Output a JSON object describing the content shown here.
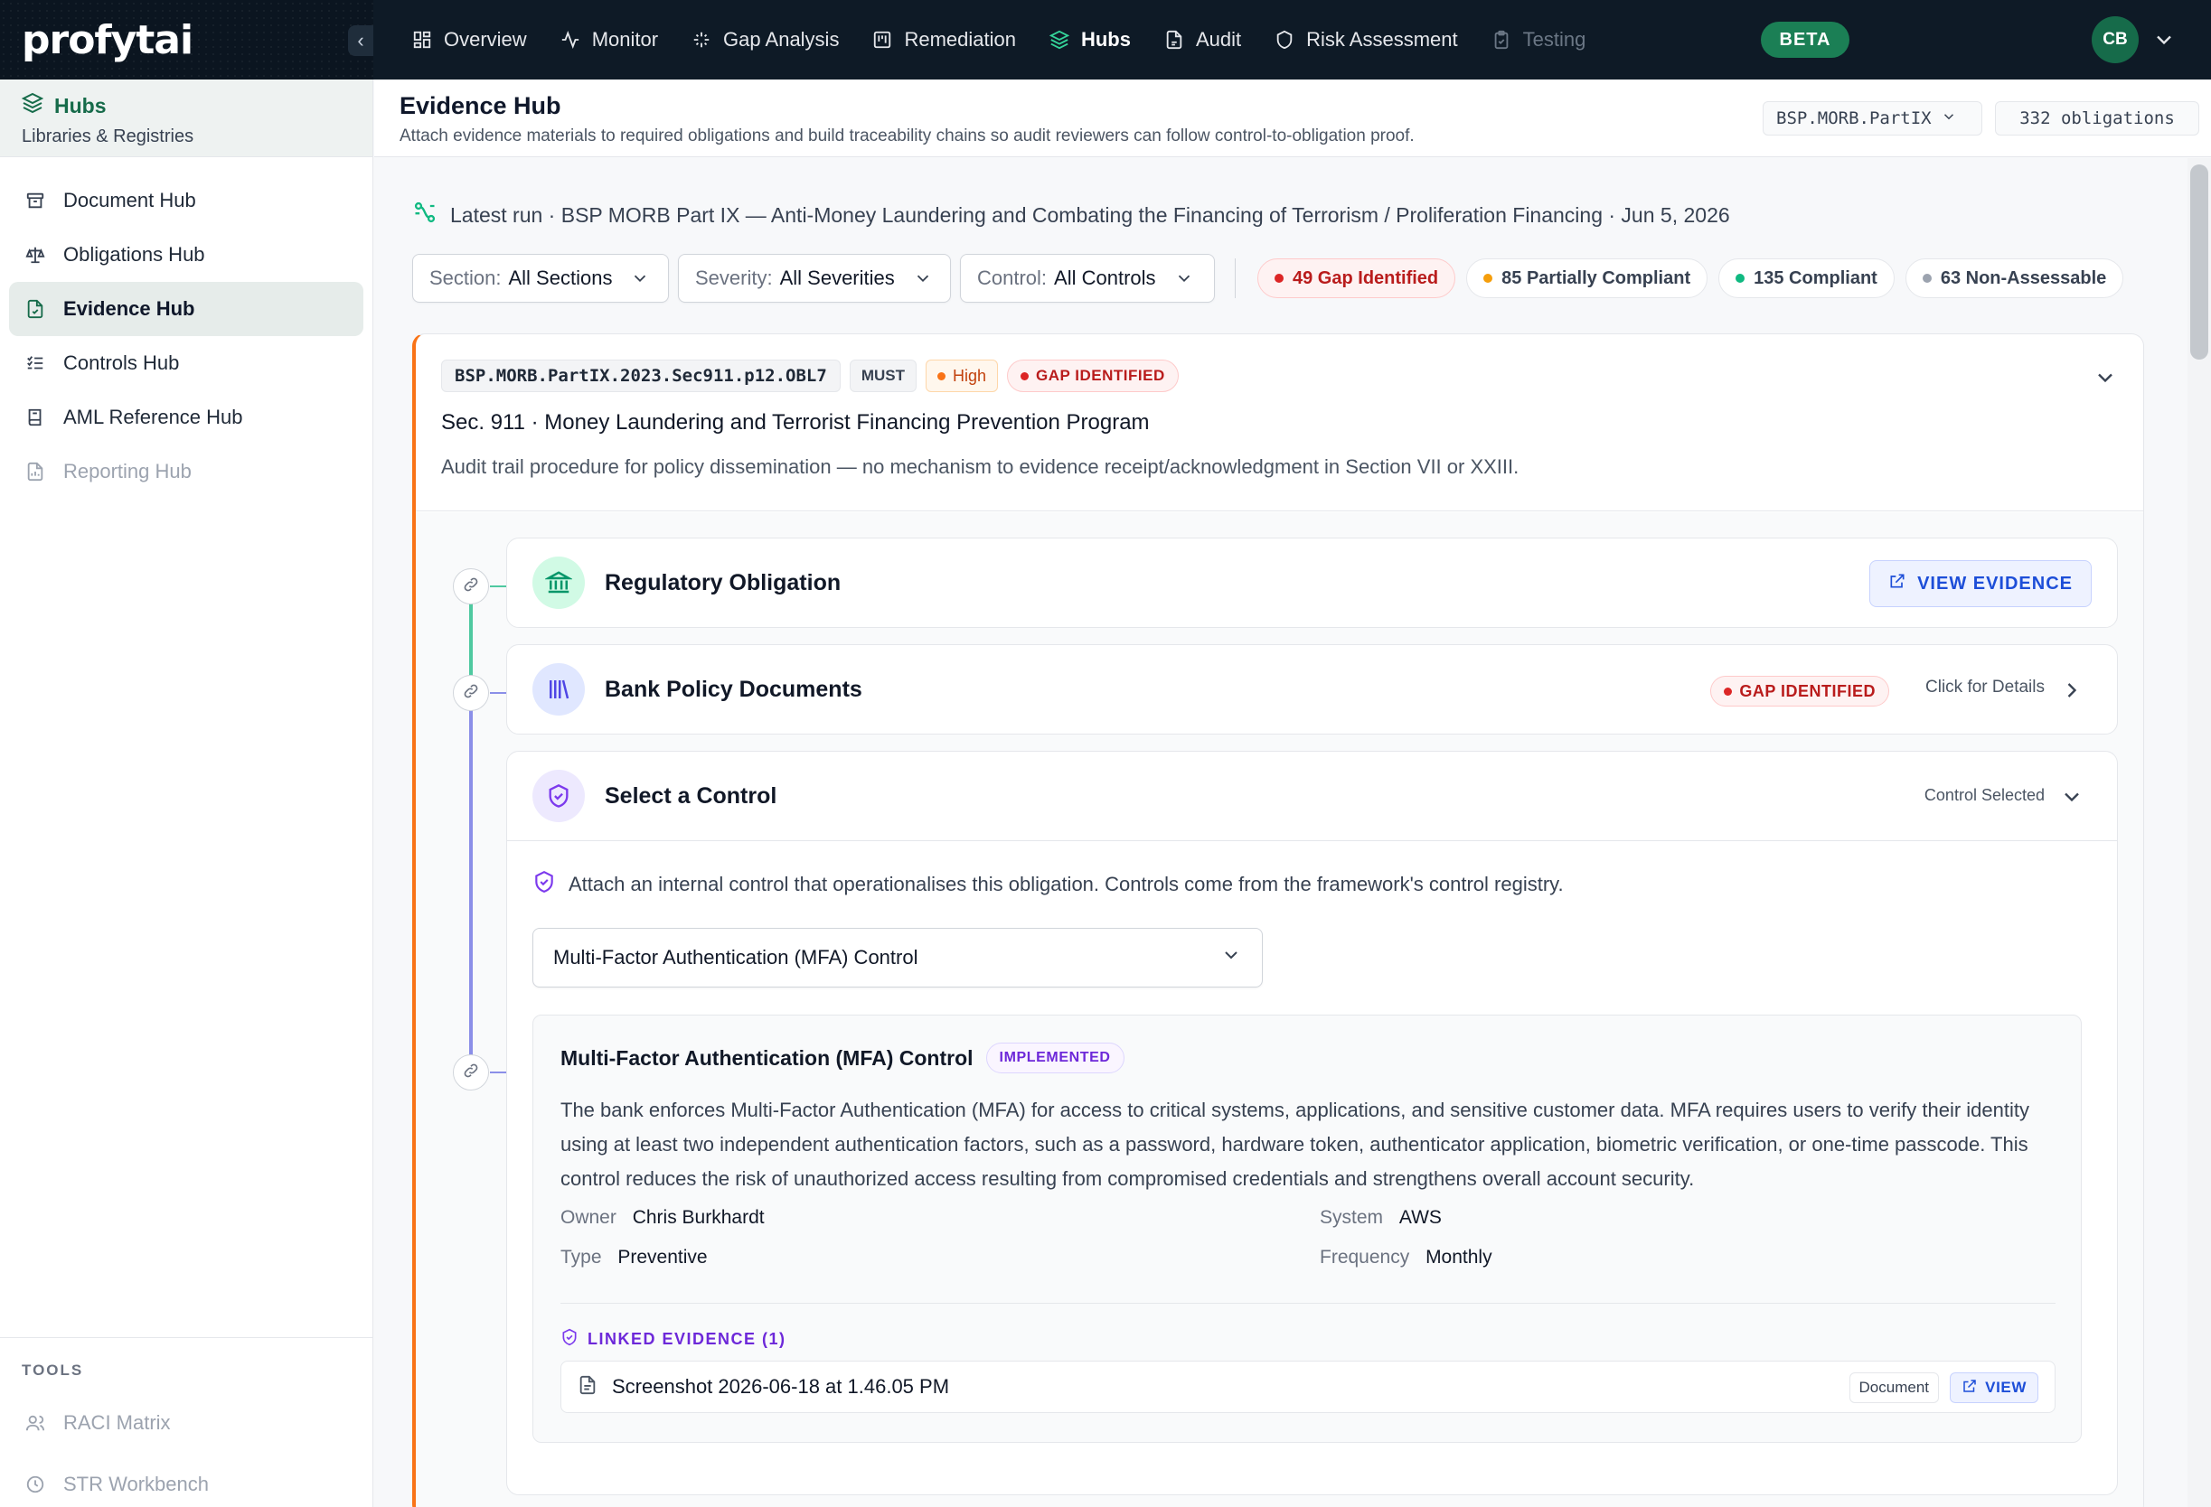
{
  "brand": {
    "logo_text": "profytai"
  },
  "nav": {
    "items": [
      {
        "label": "Overview",
        "icon": "grid-icon"
      },
      {
        "label": "Monitor",
        "icon": "activity-icon"
      },
      {
        "label": "Gap Analysis",
        "icon": "sparkle-icon"
      },
      {
        "label": "Remediation",
        "icon": "board-icon"
      },
      {
        "label": "Hubs",
        "icon": "layers-icon",
        "active": true
      },
      {
        "label": "Audit",
        "icon": "file-icon"
      },
      {
        "label": "Risk Assessment",
        "icon": "shield-icon"
      },
      {
        "label": "Testing",
        "icon": "clipboard-icon",
        "disabled": true
      }
    ],
    "beta_label": "BETA",
    "avatar_initials": "CB"
  },
  "sidebar": {
    "title": "Hubs",
    "subtitle": "Libraries & Registries",
    "items": [
      {
        "label": "Document Hub",
        "icon": "archive-icon"
      },
      {
        "label": "Obligations Hub",
        "icon": "scale-icon"
      },
      {
        "label": "Evidence Hub",
        "icon": "file-check-icon",
        "active": true
      },
      {
        "label": "Controls Hub",
        "icon": "list-check-icon"
      },
      {
        "label": "AML Reference Hub",
        "icon": "book-icon"
      },
      {
        "label": "Reporting Hub",
        "icon": "report-icon",
        "disabled": true
      }
    ],
    "tools_label": "TOOLS",
    "tools": [
      {
        "label": "RACI Matrix",
        "icon": "users-icon"
      },
      {
        "label": "STR Workbench",
        "icon": "clock-icon"
      }
    ]
  },
  "page": {
    "title": "Evidence Hub",
    "description": "Attach evidence materials to required obligations and build traceability chains so audit reviewers can follow control-to-obligation proof.",
    "framework_select": "BSP.MORB.PartIX",
    "obligation_count": "332 obligations"
  },
  "run": {
    "text": "Latest run · BSP MORB Part IX — Anti-Money Laundering and Combating the Financing of Terrorism / Proliferation Financing · Jun 5, 2026"
  },
  "filters": {
    "section": {
      "label": "Section:",
      "value": "All Sections"
    },
    "severity": {
      "label": "Severity:",
      "value": "All Severities"
    },
    "control": {
      "label": "Control:",
      "value": "All Controls"
    }
  },
  "stats": [
    {
      "label": "49 Gap Identified",
      "color": "#dc2626"
    },
    {
      "label": "85 Partially Compliant",
      "color": "#f59e0b"
    },
    {
      "label": "135 Compliant",
      "color": "#10b981"
    },
    {
      "label": "63 Non-Assessable",
      "color": "#9ca3af"
    }
  ],
  "obligation": {
    "code": "BSP.MORB.PartIX.2023.Sec911.p12.OBL7",
    "modality": "MUST",
    "severity": "High",
    "status": "GAP IDENTIFIED",
    "title": "Sec. 911 · Money Laundering and Terrorist Financing Prevention Program",
    "description": "Audit trail procedure for policy dissemination — no mechanism to evidence receipt/acknowledgment in Section VII or XXIII."
  },
  "chain": {
    "regulatory": {
      "title": "Regulatory Obligation",
      "button": "VIEW EVIDENCE"
    },
    "policy": {
      "title": "Bank Policy Documents",
      "status": "GAP IDENTIFIED",
      "details_label": "Click for Details"
    },
    "control": {
      "title": "Select a Control",
      "state_label": "Control Selected",
      "attach_text": "Attach an internal control that operationalises this obligation. Controls come from the framework's control registry.",
      "selected": "Multi-Factor Authentication (MFA) Control",
      "card": {
        "name": "Multi-Factor Authentication (MFA) Control",
        "status": "IMPLEMENTED",
        "description": "The bank enforces Multi-Factor Authentication (MFA) for access to critical systems, applications, and sensitive customer data. MFA requires users to verify their identity using at least two independent authentication factors, such as a password, hardware token, authenticator application, biometric verification, or one-time passcode. This control reduces the risk of unauthorized access resulting from compromised credentials and strengthens overall account security.",
        "owner_label": "Owner",
        "owner": "Chris Burkhardt",
        "system_label": "System",
        "system": "AWS",
        "type_label": "Type",
        "type": "Preventive",
        "frequency_label": "Frequency",
        "frequency": "Monthly",
        "linked_label": "LINKED EVIDENCE (1)",
        "evidence": {
          "name": "Screenshot 2026-06-18 at 1.46.05 PM",
          "kind": "Document",
          "action": "VIEW"
        }
      }
    }
  }
}
